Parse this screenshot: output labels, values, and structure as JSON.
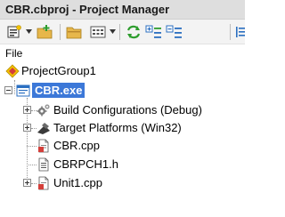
{
  "window": {
    "title": "CBR.cbproj - Project Manager"
  },
  "toolbar": {
    "buttons": [
      {
        "icon": "project-options-icon"
      },
      {
        "icon": "add-new-project-icon"
      },
      {
        "icon": "open-folder-icon"
      },
      {
        "icon": "view-options-icon"
      },
      {
        "icon": "sync-icon"
      },
      {
        "icon": "expand-all-icon"
      },
      {
        "icon": "collapse-all-icon"
      },
      {
        "icon": "extra-icon"
      }
    ]
  },
  "panel": {
    "label": "File"
  },
  "tree": {
    "group": "ProjectGroup1",
    "project": "CBR.exe",
    "items": [
      {
        "label": "Build Configurations (Debug)",
        "icon": "gear-icon"
      },
      {
        "label": "Target Platforms (Win32)",
        "icon": "target-platform-icon"
      },
      {
        "label": "CBR.cpp",
        "icon": "cpp-file-icon"
      },
      {
        "label": "CBRPCH1.h",
        "icon": "header-file-icon"
      },
      {
        "label": "Unit1.cpp",
        "icon": "unit-file-icon"
      }
    ]
  },
  "colors": {
    "selection": "#3c78d8",
    "title_bg": "#dedede",
    "toolbar_bg": "#f3f3f3"
  }
}
